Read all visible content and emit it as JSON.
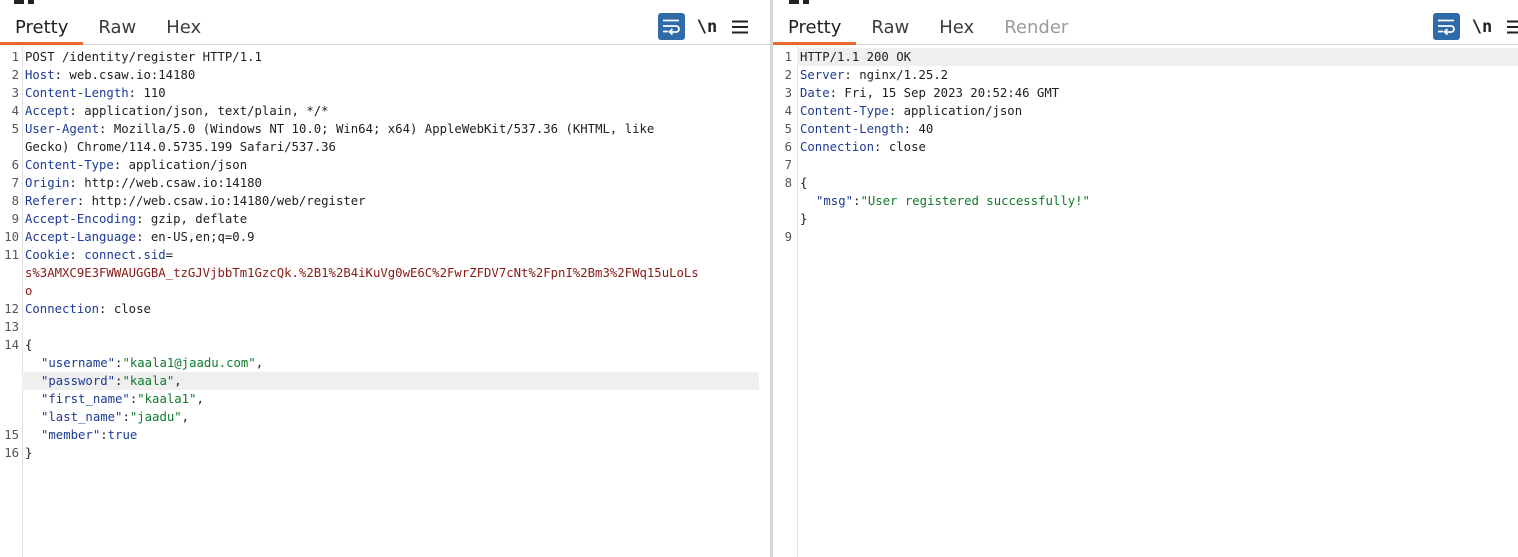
{
  "request": {
    "tabs": [
      {
        "label": "Pretty",
        "active": true
      },
      {
        "label": "Raw",
        "active": false
      },
      {
        "label": "Hex",
        "active": false
      }
    ],
    "tools": {
      "newline_label": "\\n"
    },
    "lines": [
      {
        "n": "1",
        "request_line": "POST /identity/register HTTP/1.1"
      },
      {
        "n": "2",
        "header": "Host",
        "value": " web.csaw.io:14180"
      },
      {
        "n": "3",
        "header": "Content-Length",
        "value": " 110"
      },
      {
        "n": "4",
        "header": "Accept",
        "value": " application/json, text/plain, */*"
      },
      {
        "n": "5",
        "header": "User-Agent",
        "value": " Mozilla/5.0 (Windows NT 10.0; Win64; x64) AppleWebKit/537.36 (KHTML, like",
        "cont": "Gecko) Chrome/114.0.5735.199 Safari/537.36"
      },
      {
        "n": "6",
        "header": "Content-Type",
        "value": " application/json"
      },
      {
        "n": "7",
        "header": "Origin",
        "value": " http://web.csaw.io:14180"
      },
      {
        "n": "8",
        "header": "Referer",
        "value": " http://web.csaw.io:14180/web/register"
      },
      {
        "n": "9",
        "header": "Accept-Encoding",
        "value": " gzip, deflate"
      },
      {
        "n": "10",
        "header": "Accept-Language",
        "value": " en-US,en;q=0.9"
      },
      {
        "n": "11",
        "header": "Cookie",
        "cookie_name": " connect.sid",
        "cookie_eq": "=",
        "cookie_value_1": "s%3AMXC9E3FWWAUGGBA_tzGJVjbbTm1GzcQk.%2B1%2B4iKuVg0wE6C%2FwrZFDV7cNt%2FpnI%2Bm3%2FWq15uLoLs",
        "cookie_value_2": "o"
      },
      {
        "n": "12",
        "header": "Connection",
        "value": " close"
      },
      {
        "n": "13"
      },
      {
        "n": "14",
        "text": "{"
      },
      {
        "json_key": "\"username\"",
        "sep": ":",
        "json_str": "\"kaala1@jaadu.com\"",
        "tail": ","
      },
      {
        "json_key": "\"password\"",
        "sep": ":",
        "json_str": "\"kaala\"",
        "tail": ","
      },
      {
        "json_key": "\"first_name\"",
        "sep": ":",
        "json_str": "\"kaala1\"",
        "tail": ","
      },
      {
        "json_key": "\"last_name\"",
        "sep": ":",
        "json_str": "\"jaadu\"",
        "tail": ","
      },
      {
        "n": "15",
        "json_key": "\"member\"",
        "sep": ":",
        "json_val": "true"
      },
      {
        "n": "16",
        "text": "}"
      }
    ]
  },
  "response": {
    "tabs": [
      {
        "label": "Pretty",
        "active": true
      },
      {
        "label": "Raw",
        "active": false
      },
      {
        "label": "Hex",
        "active": false
      },
      {
        "label": "Render",
        "active": false,
        "disabled": true
      }
    ],
    "tools": {
      "newline_label": "\\n"
    },
    "lines": [
      {
        "n": "1",
        "status_line": "HTTP/1.1 200 OK"
      },
      {
        "n": "2",
        "header": "Server",
        "value": " nginx/1.25.2"
      },
      {
        "n": "3",
        "header": "Date",
        "value": " Fri, 15 Sep 2023 20:52:46 GMT"
      },
      {
        "n": "4",
        "header": "Content-Type",
        "value": " application/json"
      },
      {
        "n": "5",
        "header": "Content-Length",
        "value": " 40"
      },
      {
        "n": "6",
        "header": "Connection",
        "value": " close"
      },
      {
        "n": "7"
      },
      {
        "n": "8",
        "text": "{"
      },
      {
        "json_key": "\"msg\"",
        "sep": ":",
        "json_str": "\"User registered successfully!\""
      },
      {
        "text": "}"
      },
      {
        "n": "9"
      }
    ]
  },
  "colors": {
    "accent_tab_underline": "#e8692e",
    "wrap_button_bg": "#2f6ba8",
    "header_name": "#1d3b94",
    "cookie_value": "#8a1b17",
    "json_string": "#0f7a2c"
  },
  "icons": {
    "wrap": "wrap-lines-icon",
    "newline": "newline-icon",
    "menu": "hamburger-menu-icon"
  }
}
